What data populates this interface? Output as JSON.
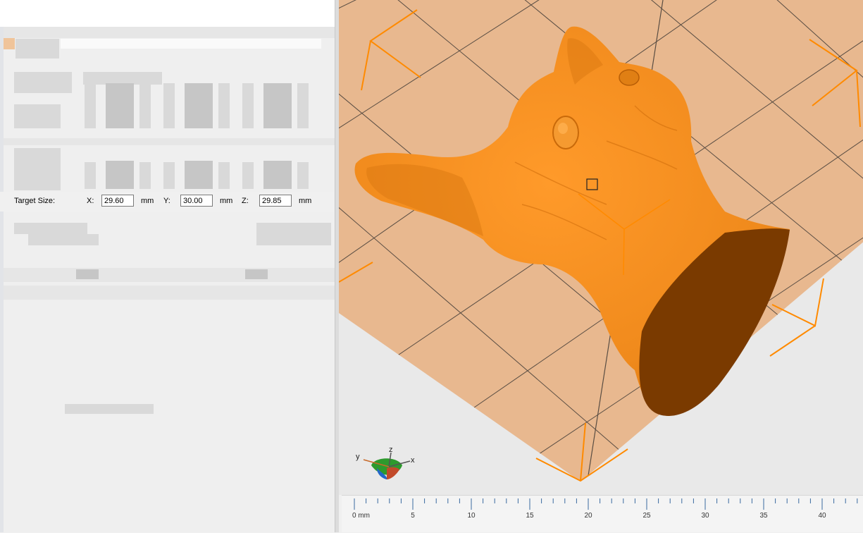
{
  "target_size": {
    "label": "Target Size:",
    "x": {
      "label": "X:",
      "value": "29.60",
      "unit": "mm"
    },
    "y": {
      "label": "Y:",
      "value": "30.00",
      "unit": "mm"
    },
    "z": {
      "label": "Z:",
      "value": "29.85",
      "unit": "mm"
    }
  },
  "viewport": {
    "model_color": "#f08a1c",
    "model_cut_color": "#7a3a00",
    "bed_color": "#e8b88f",
    "background_color": "#e9e9e9",
    "grid_line_color": "#2a2a2a",
    "corner_marker_color": "#ff8a00"
  },
  "axis_gizmo": {
    "x": "x",
    "y": "y",
    "z": "z"
  },
  "ruler": {
    "labels": [
      "0 mm",
      "5",
      "10",
      "15",
      "20",
      "25",
      "30",
      "35",
      "40"
    ],
    "minor_per_major": 5
  }
}
